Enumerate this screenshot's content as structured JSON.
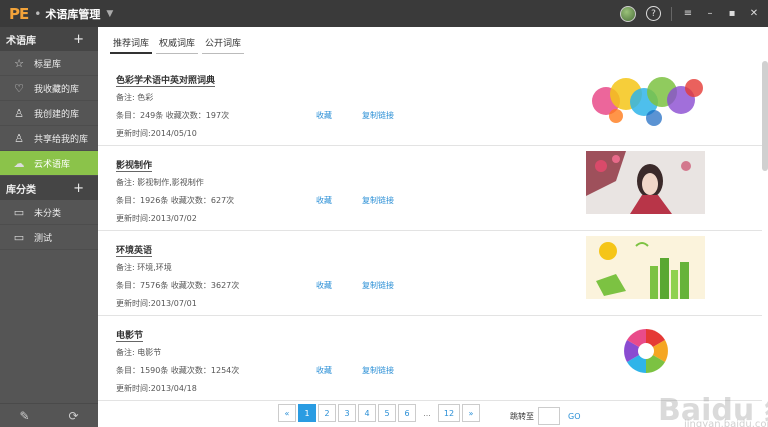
{
  "titlebar": {
    "logo": "PE",
    "title": "术语库管理"
  },
  "sidebar": {
    "section1": {
      "title": "术语库",
      "plus": "+"
    },
    "items": [
      {
        "label": "标星库",
        "icon": "star-icon"
      },
      {
        "label": "我收藏的库",
        "icon": "heart-icon"
      },
      {
        "label": "我创建的库",
        "icon": "user-icon"
      },
      {
        "label": "共享给我的库",
        "icon": "share-user-icon"
      },
      {
        "label": "云术语库",
        "icon": "cloud-icon"
      }
    ],
    "section2": {
      "title": "库分类",
      "plus": "+"
    },
    "categories": [
      {
        "label": "未分类",
        "icon": "folder-icon"
      },
      {
        "label": "测试",
        "icon": "folder-icon"
      }
    ]
  },
  "tabs": [
    {
      "label": "推荐词库"
    },
    {
      "label": "权威词库"
    },
    {
      "label": "公开词库"
    }
  ],
  "cards": [
    {
      "title": "色彩学术语中英对照词典",
      "note": "备注: 色彩",
      "meta": "条目：249条    收藏次数：197次",
      "fav": "收藏",
      "copy": "复制链接",
      "date": "更新时间:2014/05/10"
    },
    {
      "title": "影视制作",
      "note": "备注: 影视制作,影视制作",
      "meta": "条目：1926条    收藏次数：627次",
      "fav": "收藏",
      "copy": "复制链接",
      "date": "更新时间:2013/07/02"
    },
    {
      "title": "环境英语",
      "note": "备注: 环境,环境",
      "meta": "条目：7576条    收藏次数：3627次",
      "fav": "收藏",
      "copy": "复制链接",
      "date": "更新时间:2013/07/01"
    },
    {
      "title": "电影节",
      "note": "备注: 电影节",
      "meta": "条目：1590条    收藏次数：1254次",
      "fav": "收藏",
      "copy": "复制链接",
      "date": "更新时间:2013/04/18"
    }
  ],
  "pager": {
    "prev": "«",
    "next": "»",
    "dots": "...",
    "pages": [
      "1",
      "2",
      "3",
      "4",
      "5",
      "6"
    ],
    "last": "12",
    "jump_label": "跳转至",
    "go": "GO"
  },
  "watermark": {
    "text": "Baidu 经验",
    "sub": "jingyan.baidu.com"
  }
}
